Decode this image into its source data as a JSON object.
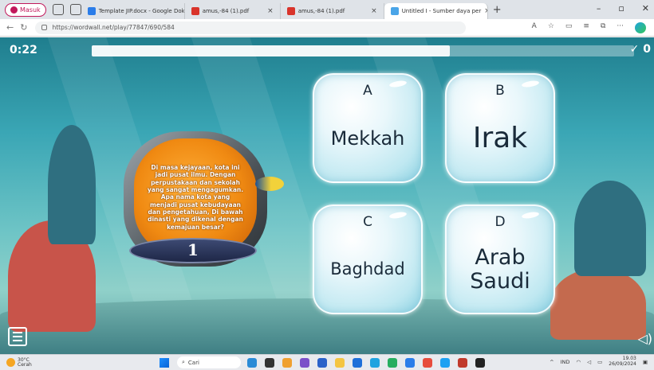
{
  "browser": {
    "profile_label": "Masuk",
    "tabs": [
      {
        "label": "Template JIP.docx - Google Doku",
        "fav_color": "#2b7de9"
      },
      {
        "label": "amus,-84 (1).pdf",
        "fav_color": "#d9342b"
      },
      {
        "label": "amus,-84 (1).pdf",
        "fav_color": "#d9342b"
      },
      {
        "label": "Untitled I - Sumber daya per",
        "fav_color": "#4aa5e8"
      }
    ],
    "url": "https://wordwall.net/play/77847/690/584"
  },
  "game": {
    "timer": "0:22",
    "progress_fraction": 0.66,
    "score": "✓ 0",
    "question": "Di masa kejayaan, kota ini jadi pusat ilmu. Dengan perpustakaan dan sekolah yang sangat mengagumkan. Apa nama kota yang menjadi pusat kebudayaan dan pengetahuan, Di bawah dinasti yang dikenal dengan kemajuan besar?",
    "question_number": "1",
    "answers": [
      {
        "letter": "A",
        "label": "Mekkah"
      },
      {
        "letter": "B",
        "label": "Irak"
      },
      {
        "letter": "C",
        "label": "Baghdad"
      },
      {
        "letter": "D",
        "label": "Arab Saudi"
      }
    ]
  },
  "taskbar": {
    "temperature": "30°C",
    "weather_text": "Cerah",
    "search_placeholder": "Cari",
    "language": "IND",
    "time": "19.03",
    "date": "26/09/2024"
  }
}
